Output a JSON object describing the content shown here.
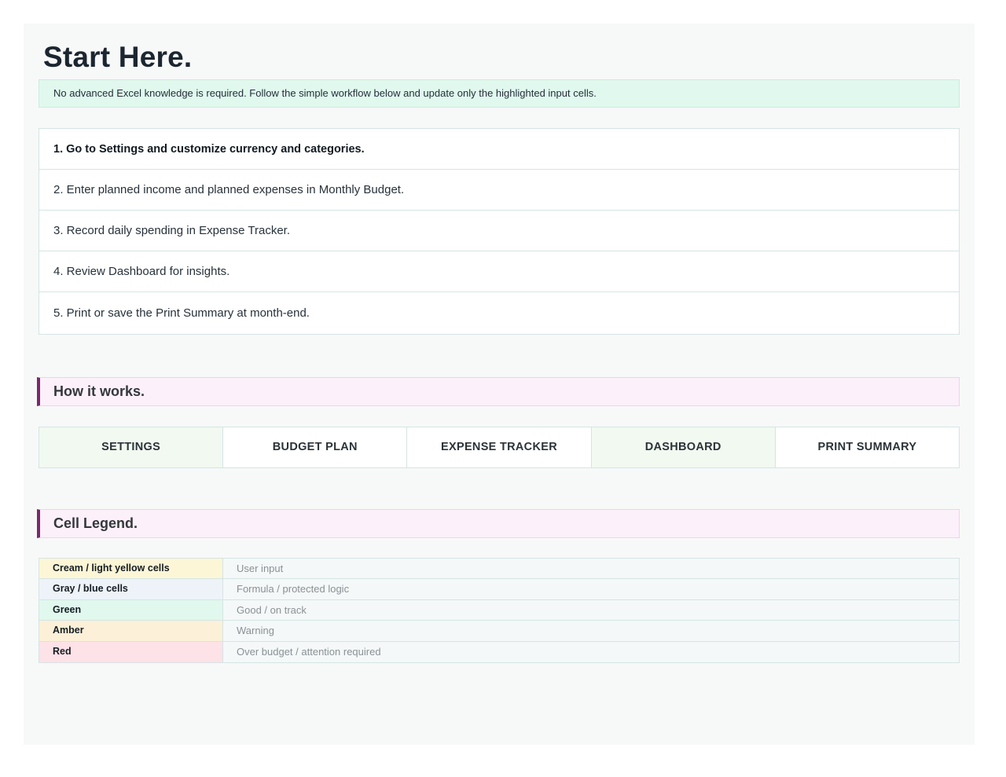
{
  "page": {
    "title": "Start Here.",
    "intro": "No advanced Excel knowledge is required. Follow the simple workflow below and update only the highlighted input cells."
  },
  "steps": [
    "1. Go to Settings and customize currency and categories.",
    "2. Enter planned income and planned expenses in Monthly Budget.",
    "3. Record daily spending in Expense Tracker.",
    "4. Review Dashboard for insights.",
    "5. Print or save the Print Summary at month-end."
  ],
  "how_it_works": {
    "heading": "How it works.",
    "items": [
      "SETTINGS",
      "BUDGET PLAN",
      "EXPENSE TRACKER",
      "DASHBOARD",
      "PRINT SUMMARY"
    ]
  },
  "legend": {
    "heading": "Cell Legend.",
    "rows": [
      {
        "key": "Cream / light yellow cells",
        "value": "User input",
        "color": "#fdf6d6"
      },
      {
        "key": "Gray / blue cells",
        "value": "Formula / protected logic",
        "color": "#eef3fa"
      },
      {
        "key": "Green",
        "value": "Good / on track",
        "color": "#e0f8ee"
      },
      {
        "key": "Amber",
        "value": "Warning",
        "color": "#fdf0d8"
      },
      {
        "key": "Red",
        "value": "Over budget / attention required",
        "color": "#fde3e8"
      }
    ]
  },
  "colors": {
    "accent_bar": "#7a2a6c",
    "section_bg": "#fcf0fa",
    "intro_bg": "#e0f8ee",
    "tint_cell": "#f2f9f0"
  }
}
